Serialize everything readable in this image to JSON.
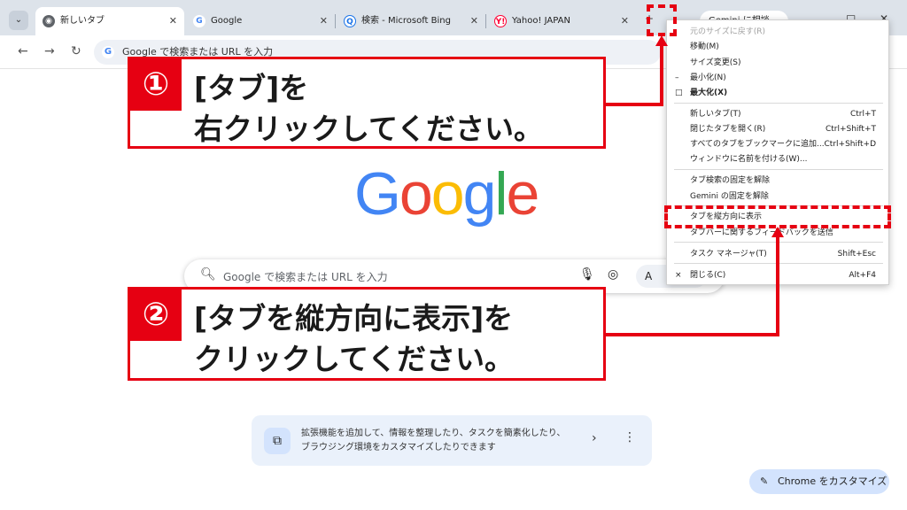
{
  "tabs": [
    {
      "label": "新しいタブ",
      "favicon": "chrome-icon"
    },
    {
      "label": "Google",
      "favicon": "google-icon"
    },
    {
      "label": "検索 - Microsoft Bing",
      "favicon": "bing-icon"
    },
    {
      "label": "Yahoo! JAPAN",
      "favicon": "yahoo-icon"
    }
  ],
  "toolbar": {
    "omnibox_text": "Google で検索または URL を入力",
    "gemini_label": "Gemini に相談"
  },
  "ntp": {
    "logo_letters": [
      "G",
      "o",
      "o",
      "g",
      "l",
      "e"
    ],
    "search_placeholder": "Google で検索または URL を入力",
    "ai_mode_label": "A",
    "chip_text": "拡張機能を追加して、情報を整理したり、タスクを簡素化したり、ブラウジング環境をカスタマイズしたりできます",
    "customize_label": "Chrome をカスタマイズ"
  },
  "menu": {
    "items": [
      {
        "label": "元のサイズに戻す(R)",
        "shortcut": "",
        "disabled": true,
        "bold": false,
        "mark": ""
      },
      {
        "label": "移動(M)",
        "shortcut": "",
        "disabled": false,
        "bold": false,
        "mark": ""
      },
      {
        "label": "サイズ変更(S)",
        "shortcut": "",
        "disabled": false,
        "bold": false,
        "mark": ""
      },
      {
        "label": "最小化(N)",
        "shortcut": "",
        "disabled": false,
        "bold": false,
        "mark": "–"
      },
      {
        "label": "最大化(X)",
        "shortcut": "",
        "disabled": false,
        "bold": true,
        "mark": "□"
      },
      {
        "label": "新しいタブ(T)",
        "shortcut": "Ctrl+T",
        "disabled": false,
        "bold": false,
        "mark": ""
      },
      {
        "label": "閉じたタブを開く(R)",
        "shortcut": "Ctrl+Shift+T",
        "disabled": false,
        "bold": false,
        "mark": ""
      },
      {
        "label": "すべてのタブをブックマークに追加...",
        "shortcut": "Ctrl+Shift+D",
        "disabled": false,
        "bold": false,
        "mark": ""
      },
      {
        "label": "ウィンドウに名前を付ける(W)...",
        "shortcut": "",
        "disabled": false,
        "bold": false,
        "mark": ""
      },
      {
        "label": "タブ検索の固定を解除",
        "shortcut": "",
        "disabled": false,
        "bold": false,
        "mark": ""
      },
      {
        "label": "Gemini の固定を解除",
        "shortcut": "",
        "disabled": false,
        "bold": false,
        "mark": ""
      },
      {
        "label": "タブを縦方向に表示",
        "shortcut": "",
        "disabled": false,
        "bold": false,
        "mark": ""
      },
      {
        "label": "タブバーに関するフィードバックを送信",
        "shortcut": "",
        "disabled": false,
        "bold": false,
        "mark": ""
      },
      {
        "label": "タスク マネージャ(T)",
        "shortcut": "Shift+Esc",
        "disabled": false,
        "bold": false,
        "mark": ""
      },
      {
        "label": "閉じる(C)",
        "shortcut": "Alt+F4",
        "disabled": false,
        "bold": false,
        "mark": "×"
      }
    ]
  },
  "annotations": {
    "step1": {
      "number": "①",
      "line1": "[タブ]を",
      "line2": "右クリックしてください。"
    },
    "step2": {
      "number": "②",
      "line1": "[タブを縦方向に表示]を",
      "line2": "クリックしてください。"
    },
    "accent_color": "#e60012"
  }
}
